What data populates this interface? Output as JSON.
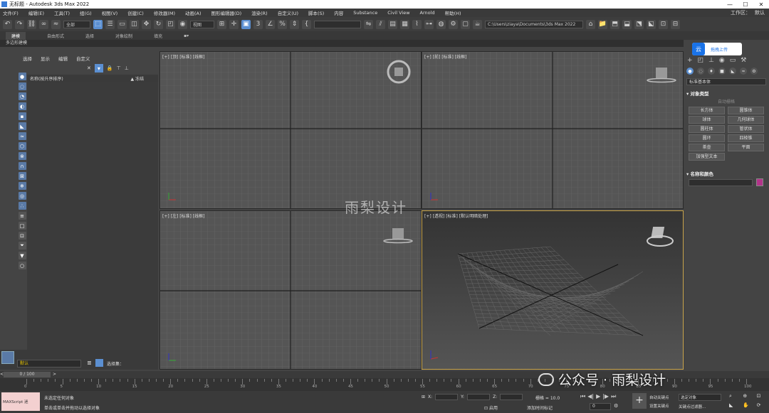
{
  "window": {
    "title": "无标题 - Autodesk 3ds Max 2022",
    "controls": [
      "—",
      "☐",
      "✕"
    ]
  },
  "menu": {
    "items": [
      "文件(F)",
      "编辑(E)",
      "工具(T)",
      "组(G)",
      "视图(V)",
      "创建(C)",
      "修改器(M)",
      "动画(A)",
      "图形编辑器(D)",
      "渲染(R)",
      "自定义(U)",
      "脚本(S)",
      "内容",
      "Substance",
      "Civil View",
      "Arnold",
      "帮助(H)"
    ],
    "workspace_label": "工作区：",
    "workspace_value": "默认"
  },
  "toolbar": {
    "filter_value": "全部",
    "ref_coord": "视图",
    "named_sel": "",
    "path": "C:\\Users\\ziaya\\Documents\\3ds Max 2022"
  },
  "ribbon": {
    "tabs": [
      "建模",
      "自由形式",
      "选择",
      "对象绘制",
      "填充"
    ],
    "selected": "建模",
    "sub_label": "多边形建模"
  },
  "explorer": {
    "tabs": [
      "选择",
      "显示",
      "编辑",
      "自定义"
    ],
    "col_name": "名称(按升序排序)",
    "col_frozen": "▲ 冻结"
  },
  "viewports": {
    "top": "[+] [顶] [标准] [线框]",
    "front": "[+] [前] [标准] [线框]",
    "left": "[+] [左] [标准] [线框]",
    "persp": "[+] [透视] [标准] [默认明暗处理]"
  },
  "cloud": {
    "icon": "云",
    "label": "拖拽上传"
  },
  "command_panel": {
    "category": "标准基本体",
    "rollout_object_type": "对象类型",
    "autogrid": "自动栅格",
    "objects": [
      "长方体",
      "圆锥体",
      "球体",
      "几何球体",
      "圆柱体",
      "管状体",
      "圆环",
      "四棱锥",
      "茶壶",
      "平面",
      "加强型文本"
    ],
    "rollout_name_color": "名称和颜色",
    "color": "#b3338a"
  },
  "left_bottom": {
    "layer": "默认",
    "selection_set": "选择集："
  },
  "timeline": {
    "slider": "0 / 100",
    "ticks": [
      "0",
      "5",
      "10",
      "15",
      "20",
      "25",
      "30",
      "35",
      "40",
      "45",
      "50",
      "55",
      "60",
      "65",
      "70",
      "75",
      "80",
      "85",
      "90",
      "95",
      "100"
    ]
  },
  "status": {
    "maxscript": "MAXScript 迷",
    "line1": "未选定任何对象",
    "line2": "单击或单击并拖动以选择对象",
    "x_label": "X:",
    "y_label": "Y:",
    "z_label": "Z:",
    "grid": "栅格 = 10.0",
    "enable": "启用",
    "add_time_tag": "添加时间标记",
    "frame": "0",
    "auto_key": "自动关键点",
    "set_key": "设置关键点",
    "key_filter": "关键点过滤器...",
    "key_select": "选定对象"
  },
  "watermarks": {
    "center": "雨梨设计",
    "bottom": "公众号 · 雨梨设计"
  }
}
